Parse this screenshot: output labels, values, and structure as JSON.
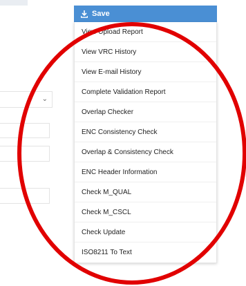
{
  "save_button": {
    "label": "Save",
    "icon": "download-icon",
    "color": "#4a8fd4"
  },
  "menu": {
    "items": [
      {
        "label": "View Upload Report"
      },
      {
        "label": "View VRC History"
      },
      {
        "label": "View E-mail History"
      },
      {
        "label": "Complete Validation Report"
      },
      {
        "label": "Overlap Checker"
      },
      {
        "label": "ENC Consistency Check"
      },
      {
        "label": "Overlap & Consistency Check"
      },
      {
        "label": "ENC Header Information"
      },
      {
        "label": "Check M_QUAL"
      },
      {
        "label": "Check M_CSCL"
      },
      {
        "label": "Check Update"
      },
      {
        "label": "ISO8211 To Text"
      }
    ]
  },
  "annotation": {
    "shape": "ellipse",
    "color": "#e10000"
  },
  "background_form": {
    "select_icon": "chevron-down-icon"
  }
}
